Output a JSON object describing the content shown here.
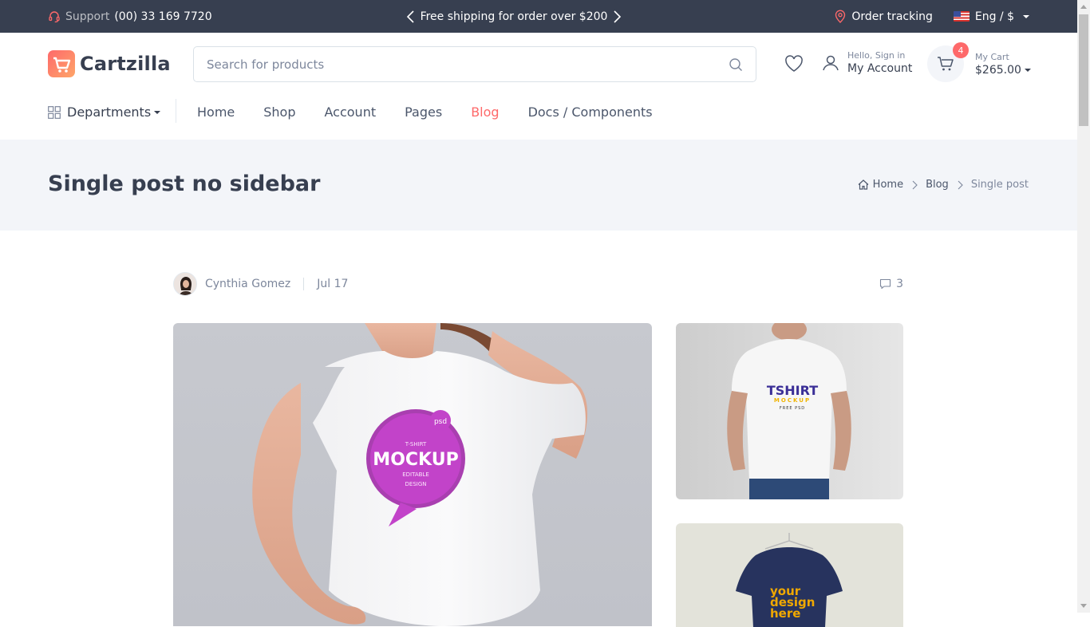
{
  "topbar": {
    "support_label": "Support",
    "support_phone": "(00) 33 169 7720",
    "promo_text": "Free shipping for order over $200",
    "order_tracking": "Order tracking",
    "lang_currency": "Eng / $"
  },
  "header": {
    "brand": "Cartzilla",
    "search_placeholder": "Search for products",
    "account_small": "Hello, Sign in",
    "account_big": "My Account",
    "cart_count": "4",
    "cart_small": "My Cart",
    "cart_total": "$265.00"
  },
  "nav": {
    "departments": "Departments",
    "links": [
      "Home",
      "Shop",
      "Account",
      "Pages",
      "Blog",
      "Docs / Components"
    ],
    "active": "Blog"
  },
  "page": {
    "title": "Single post no sidebar",
    "breadcrumb": [
      "Home",
      "Blog",
      "Single post"
    ]
  },
  "post": {
    "author": "Cynthia Gomez",
    "date": "Jul 17",
    "comments": "3"
  },
  "images": {
    "main_text_1": "psd",
    "main_text_2": "T-SHIRT",
    "main_text_3": "MOCKUP",
    "main_text_4": "EDITABLE",
    "main_text_5": "DESIGN",
    "side1_text_1": "TSHIRT",
    "side1_text_2": "MOCKUP",
    "side1_text_3": "FREE PSD",
    "side2_text_1": "your",
    "side2_text_2": "design",
    "side2_text_3": "here"
  },
  "colors": {
    "topbar_bg": "#373f50",
    "accent": "#fe696a",
    "band_bg": "#f3f5f9"
  }
}
